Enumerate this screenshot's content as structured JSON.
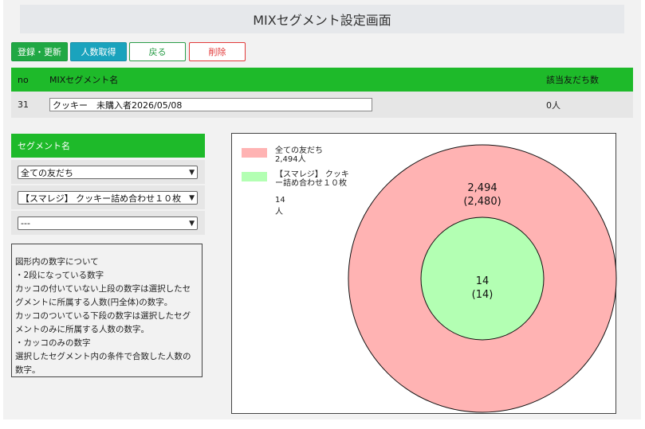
{
  "page_title": "MIXセグメント設定画面",
  "toolbar": {
    "register_label": "登録・更新",
    "fetch_count_label": "人数取得",
    "back_label": "戻る",
    "delete_label": "削除"
  },
  "mix_table": {
    "headers": {
      "no": "no",
      "name": "MIXセグメント名",
      "count": "該当友だち数"
    },
    "row": {
      "no": "31",
      "name": "クッキー　未購入者2026/05/08",
      "count": "0人"
    }
  },
  "segments": {
    "header": "セグメント名",
    "selects": [
      "全ての友だち",
      "【スマレジ】 クッキー詰め合わせ１０枚",
      "---"
    ]
  },
  "note": {
    "lines": [
      "図形内の数字について",
      "・2段になっている数字",
      "カッコの付いていない上段の数字は選択したセグメントに所属する人数(円全体)の数字。",
      "カッコのついている下段の数字は選択したセグメントのみに所属する人数の数字。",
      "・カッコのみの数字",
      "選択したセグメント内の条件で合致した人数の数字。"
    ]
  },
  "colors": {
    "accent_green": "#1eba2a",
    "button_green": "#20a844",
    "button_teal": "#1aa3bd",
    "danger_red": "#e23a3a",
    "outer_circle": "#ffb3b3",
    "inner_circle": "#b3ffb3"
  },
  "chart_data": {
    "type": "venn-nested",
    "series": [
      {
        "name": "全ての友だち",
        "legend_count": "2,494人",
        "value_label": "2,494",
        "sub_label": "(2,480)",
        "value": 2494,
        "exclusive": 2480,
        "color": "#ffb3b3"
      },
      {
        "name": "【スマレジ】 クッキー詰め合わせ１０枚",
        "legend_count": "14人",
        "value_label": "14",
        "sub_label": "(14)",
        "value": 14,
        "exclusive": 14,
        "color": "#b3ffb3"
      }
    ]
  }
}
